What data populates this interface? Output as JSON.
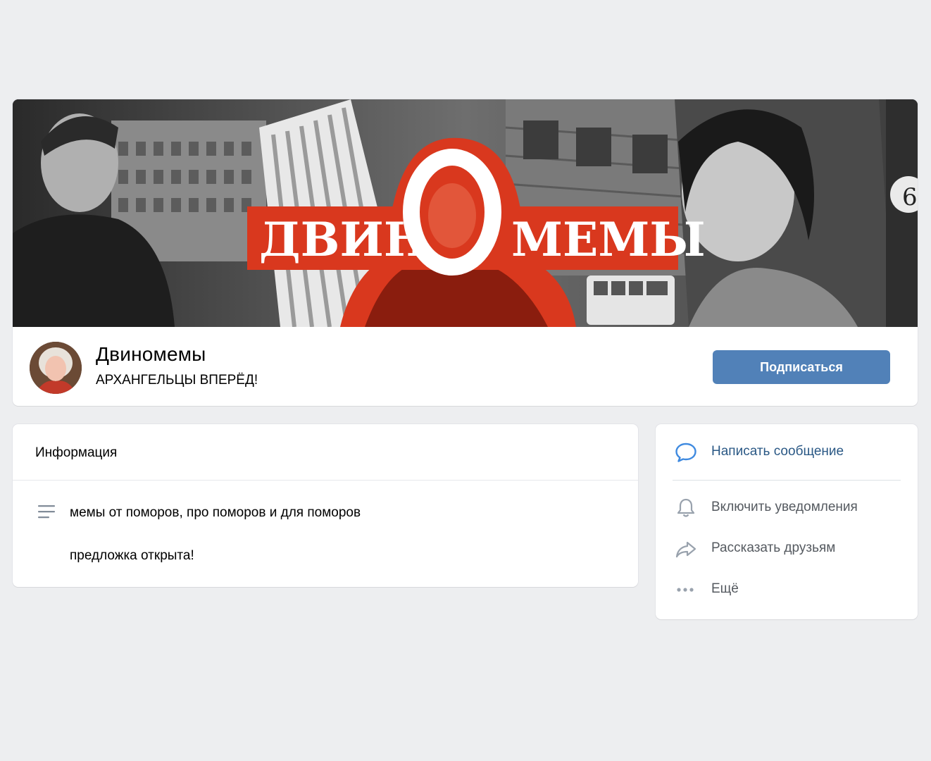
{
  "cover": {
    "logo_left": "ДВИН",
    "logo_o": "О",
    "logo_right": "МЕМЫ",
    "side_text": "6"
  },
  "group": {
    "name": "Двиномемы",
    "status": "АРХАНГЕЛЬЦЫ ВПЕРЁД!",
    "subscribe_label": "Подписаться"
  },
  "info": {
    "title": "Информация",
    "description_line1": "мемы от поморов, про поморов и для поморов",
    "description_line2": "предложка открыта!"
  },
  "actions": {
    "message": "Написать сообщение",
    "notifications": "Включить уведомления",
    "share": "Рассказать друзьям",
    "more": "Ещё"
  },
  "colors": {
    "page_bg": "#edeef0",
    "accent": "#5181b8",
    "link": "#2a5885",
    "cover_red": "#d9381e"
  },
  "icons": [
    "comment-icon",
    "bell-icon",
    "share-icon",
    "more-icon",
    "text-lines-icon"
  ]
}
